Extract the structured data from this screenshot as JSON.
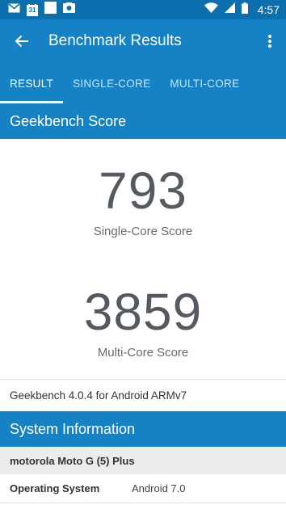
{
  "statusbar": {
    "time": "4:57",
    "icons_left": [
      "gmail-icon",
      "calendar-icon",
      "square-icon",
      "photo-icon"
    ],
    "calendar_day": "31",
    "icons_right": [
      "wifi-icon",
      "signal-icon",
      "battery-icon"
    ]
  },
  "appbar": {
    "title": "Benchmark Results"
  },
  "tabs": [
    {
      "label": "RESULT",
      "active": true
    },
    {
      "label": "SINGLE-CORE",
      "active": false
    },
    {
      "label": "MULTI-CORE",
      "active": false
    }
  ],
  "geekbench": {
    "header": "Geekbench Score",
    "single_score": "793",
    "single_label": "Single-Core Score",
    "multi_score": "3859",
    "multi_label": "Multi-Core Score",
    "version": "Geekbench 4.0.4 for Android ARMv7"
  },
  "system": {
    "header": "System Information",
    "device": "motorola Moto G (5) Plus",
    "rows": [
      {
        "key": "Operating System",
        "value": "Android 7.0"
      }
    ]
  },
  "colors": {
    "statusbar": "#0c6fae",
    "primary": "#1582c6",
    "score_text": "#545a60"
  }
}
